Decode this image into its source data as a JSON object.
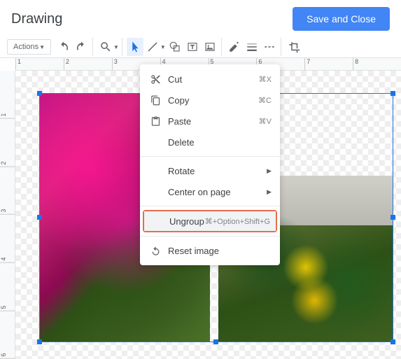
{
  "header": {
    "title": "Drawing",
    "save_button": "Save and Close"
  },
  "toolbar": {
    "actions_label": "Actions"
  },
  "ruler": {
    "h": [
      "1",
      "2",
      "3",
      "4",
      "5",
      "6",
      "7",
      "8"
    ],
    "v": [
      "1",
      "2",
      "3",
      "4",
      "5",
      "6"
    ]
  },
  "context_menu": {
    "cut": {
      "label": "Cut",
      "shortcut": "⌘X"
    },
    "copy": {
      "label": "Copy",
      "shortcut": "⌘C"
    },
    "paste": {
      "label": "Paste",
      "shortcut": "⌘V"
    },
    "delete": {
      "label": "Delete"
    },
    "rotate": {
      "label": "Rotate"
    },
    "center": {
      "label": "Center on page"
    },
    "ungroup": {
      "label": "Ungroup",
      "shortcut": "⌘+Option+Shift+G"
    },
    "reset": {
      "label": "Reset image"
    }
  }
}
